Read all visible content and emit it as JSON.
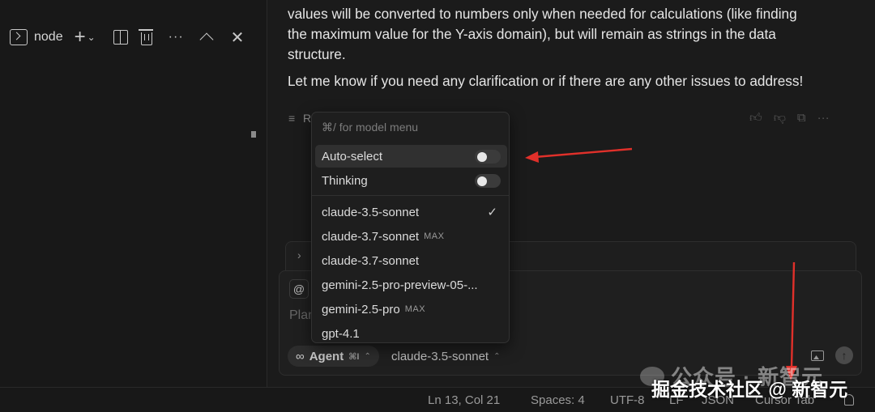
{
  "terminal": {
    "name": "node"
  },
  "chat": {
    "line1": "values will be converted to numbers only when needed for calculations (like finding",
    "line2": "the maximum value for the Y-axis domain), but will remain as strings in the data",
    "line3": "structure.",
    "line4": "Let me know if you need any clarification or if there are any other issues to address!",
    "reply_label": "R"
  },
  "model_menu": {
    "hint": "⌘/ for model menu",
    "auto_select": "Auto-select",
    "thinking": "Thinking",
    "models": [
      {
        "name": "claude-3.5-sonnet",
        "badge": "",
        "checked": "✓"
      },
      {
        "name": "claude-3.7-sonnet",
        "badge": "MAX"
      },
      {
        "name": "claude-3.7-sonnet",
        "badge": ""
      },
      {
        "name": "gemini-2.5-pro-preview-05-...",
        "badge": ""
      },
      {
        "name": "gemini-2.5-pro",
        "badge": "MAX"
      },
      {
        "name": "gpt-4.1",
        "badge": ""
      }
    ]
  },
  "composer": {
    "at_symbol": "@",
    "placeholder": "Plan",
    "mode_icon": "∞",
    "mode": "Agent",
    "mode_shortcut": "⌘I",
    "model": "claude-3.5-sonnet",
    "send_icon": "↑"
  },
  "status_bar": {
    "position": "Ln 13, Col 21",
    "spaces": "Spaces: 4",
    "encoding": "UTF-8",
    "eol": "LF",
    "language": "JSON",
    "cursor_tab": "Cursor Tab"
  },
  "watermarks": {
    "wechat": "公众号 · 新智元",
    "juejin": "掘金技术社区 @ 新智元"
  },
  "colors": {
    "annotation_arrow": "#e0302a"
  }
}
